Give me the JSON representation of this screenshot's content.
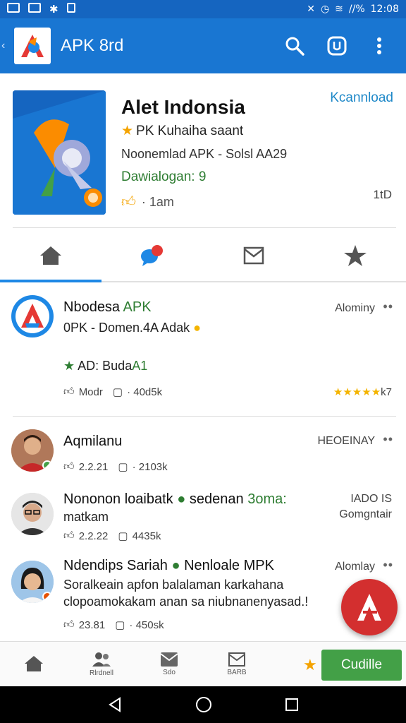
{
  "status_bar": {
    "time": "12:08",
    "battery": "//%"
  },
  "app_bar": {
    "title": "APK 8rd"
  },
  "header": {
    "app_name": "Alet Indonsia",
    "download_label": "Kcannload",
    "developer": "PK Kuhaiha saant",
    "description": "Noonemlad APK - Solsl AA29",
    "downloads": "Dawialogan: 9",
    "likes": "· 1am",
    "right_number": "1tD"
  },
  "tabs": [
    {
      "name": "home"
    },
    {
      "name": "chat"
    },
    {
      "name": "mail"
    },
    {
      "name": "star"
    }
  ],
  "posts": [
    {
      "name": "Nbodesa",
      "name_accent": "APK",
      "meta": "Alominy",
      "subtitle": "0PK - Domen.4A Adak",
      "badge_text": "AD: Buda",
      "badge_accent": "A1",
      "likes": "Modr",
      "comments": "· 40d5k",
      "rating": "k7"
    },
    {
      "name": "Aqmilanu",
      "meta": "HEOEINAY",
      "likes": "2.2.21",
      "comments": "· 2103k"
    },
    {
      "name": "Nononon loaibatk",
      "name_suffix": "sedenan",
      "name_accent": "3oma:",
      "line2": "matkam",
      "meta_line1": "IADO IS",
      "meta_line2": "Gomgntair",
      "likes": "2.2.22",
      "comments": "4435k"
    },
    {
      "name": "Ndendips Sariah",
      "name_suffix": "Nenloale MPK",
      "meta": "Alomlay",
      "text_line1": "Soralkeain apfon balalaman karkahana",
      "text_line2": "clopoamokakam anan sa niubnanenyasad.!",
      "likes": "23.81",
      "comments": "· 450sk"
    }
  ],
  "bottom_nav": [
    {
      "label": ""
    },
    {
      "label": "Rlrdnell"
    },
    {
      "label": "Sdo"
    },
    {
      "label": "BARB"
    }
  ],
  "cta": {
    "label": "Cudille"
  },
  "colors": {
    "primary": "#1976d2",
    "accent_green": "#43a047",
    "fab_red": "#d32f2f"
  }
}
